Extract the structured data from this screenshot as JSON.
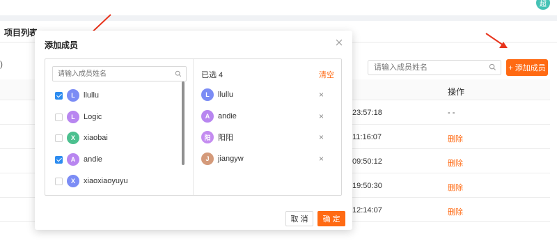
{
  "topbar": {
    "user_initial": "超"
  },
  "panel": {
    "title": "项目列表",
    "paren": ")"
  },
  "toolbar": {
    "search_placeholder": "请输入成员姓名",
    "add_label": "+ 添加成员"
  },
  "table": {
    "ops_header": "操作",
    "rows": [
      {
        "time": "23:57:18",
        "op": "- -"
      },
      {
        "time": "11:16:07",
        "op": "删除"
      },
      {
        "time": "09:50:12",
        "op": "删除"
      },
      {
        "time": "19:50:30",
        "op": "删除"
      },
      {
        "time": "12:14:07",
        "op": "删除"
      }
    ]
  },
  "modal": {
    "title": "添加成员",
    "search_placeholder": "请输入成员姓名",
    "members": [
      {
        "initial": "L",
        "name": "llullu",
        "checked": true,
        "color": "#7b8cf5"
      },
      {
        "initial": "L",
        "name": "Logic",
        "checked": false,
        "color": "#b886f0"
      },
      {
        "initial": "X",
        "name": "xiaobai",
        "checked": false,
        "color": "#4cc08f"
      },
      {
        "initial": "A",
        "name": "andie",
        "checked": true,
        "color": "#b886f0"
      },
      {
        "initial": "X",
        "name": "xiaoxiaoyuyu",
        "checked": false,
        "color": "#7b8cf5"
      }
    ],
    "selected_label": "已选 4",
    "clear_label": "清空",
    "selected": [
      {
        "initial": "L",
        "name": "llullu",
        "color": "#7b8cf5"
      },
      {
        "initial": "A",
        "name": "andie",
        "color": "#b886f0"
      },
      {
        "initial": "阳",
        "name": "阳阳",
        "color": "#c48cf0"
      },
      {
        "initial": "J",
        "name": "jiangyw",
        "color": "#d49a7a"
      }
    ],
    "cancel_label": "取 消",
    "ok_label": "确 定"
  },
  "colors": {
    "accent": "#ff6a13",
    "checkbox": "#2d8cf0",
    "arrow": "#e8341c"
  }
}
